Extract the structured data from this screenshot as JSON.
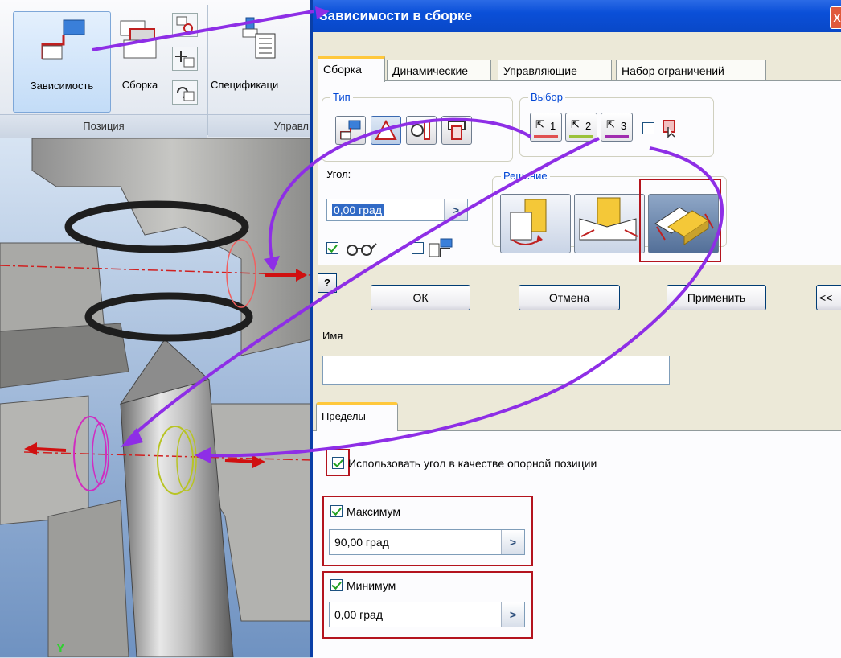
{
  "ribbon": {
    "constraint_label": "Зависимость",
    "assemble_label": "Сборка",
    "spec_label": "Спецификаци",
    "group_position": "Позиция",
    "group_manage": "Управл"
  },
  "viewport": {
    "axis_y": "Y"
  },
  "dialog": {
    "title": "Зависимости в сборке",
    "close": "X",
    "tabs": [
      "Сборка",
      "Динамические",
      "Управляющие",
      "Набор ограничений"
    ],
    "type_group": "Тип",
    "select_group": "Выбор",
    "select_buttons": [
      "1",
      "2",
      "3"
    ],
    "angle_label": "Угол:",
    "angle_value": "0,00 град",
    "solution_group": "Решение",
    "help": "?",
    "ok": "ОК",
    "cancel": "Отмена",
    "apply": "Применить",
    "collapse": "<<",
    "name_label": "Имя",
    "name_value": "",
    "limits_tab": "Пределы",
    "use_offset_label": "Использовать угол в качестве опорной позиции",
    "max_label": "Максимум",
    "max_value": "90,00 град",
    "min_label": "Минимум",
    "min_value": "0,00 град"
  },
  "colors": {
    "annotation_arrow": "#8e2ee6",
    "highlight_box": "#b4141e",
    "title_bar": "#0a4fd8",
    "select1": "#e05050",
    "select2": "#9bc23a",
    "select3": "#a02caf"
  }
}
